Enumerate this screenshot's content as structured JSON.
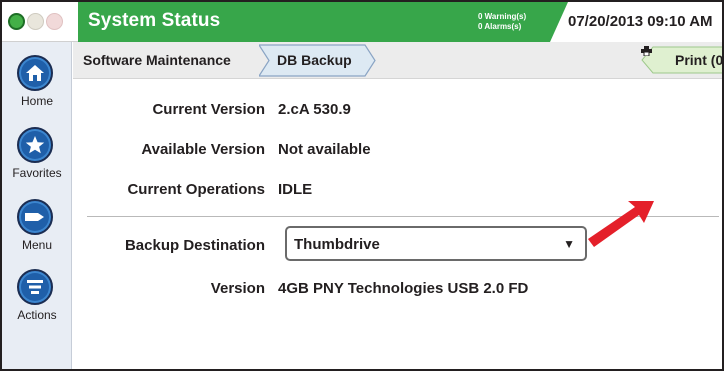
{
  "header": {
    "title": "System Status",
    "warnings": "0 Warning(s)",
    "alarms": "0 Alarms(s)",
    "datetime": "07/20/2013 09:10 AM",
    "status_lights": [
      "green",
      "yellow",
      "red"
    ],
    "accent_color": "#37a64a"
  },
  "sidebar": {
    "items": [
      {
        "label": "Home",
        "icon": "home-icon"
      },
      {
        "label": "Favorites",
        "icon": "star-icon"
      },
      {
        "label": "Menu",
        "icon": "menu-arrow-icon"
      },
      {
        "label": "Actions",
        "icon": "actions-list-icon"
      }
    ]
  },
  "breadcrumb": {
    "items": [
      "Software Maintenance",
      "DB Backup"
    ]
  },
  "print": {
    "label": "Print (0",
    "icon": "printer-icon"
  },
  "main": {
    "current_version_label": "Current Version",
    "current_version_value": "2.cA 530.9",
    "available_version_label": "Available Version",
    "available_version_value": "Not available",
    "current_operations_label": "Current Operations",
    "current_operations_value": "IDLE",
    "backup_destination_label": "Backup Destination",
    "backup_destination_value": "Thumbdrive",
    "version_label": "Version",
    "version_value": "4GB PNY Technologies USB 2.0 FD"
  },
  "annotation": {
    "arrow_color": "#e4202a"
  }
}
